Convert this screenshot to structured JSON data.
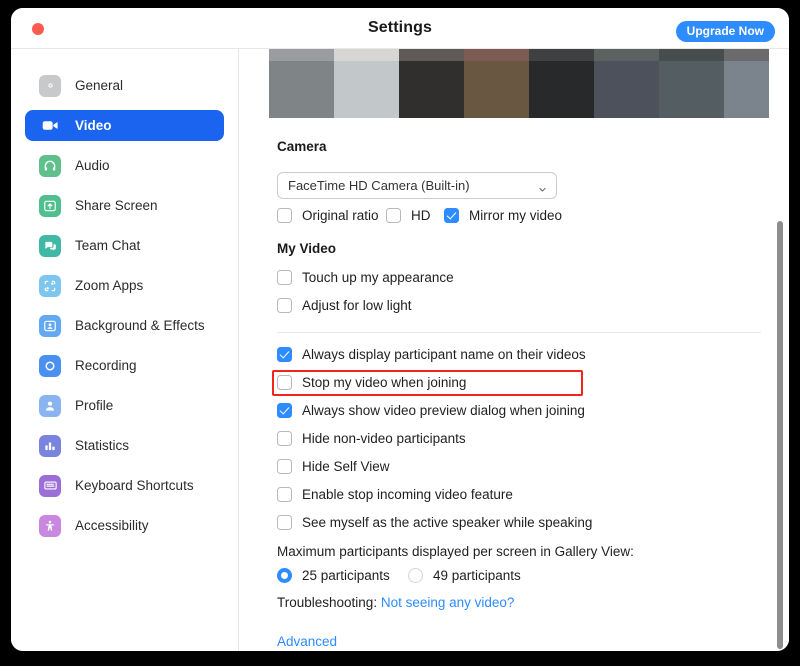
{
  "window": {
    "title": "Settings",
    "close_button": "close-window",
    "upgrade_label": "Upgrade Now",
    "accent": "#2d8cff",
    "active_nav_bg": "#1a64ef",
    "highlight_color": "#f3251a"
  },
  "sidebar": {
    "items": [
      {
        "label": "General",
        "icon": "gear-icon",
        "color": "#c8c9cb",
        "active": false
      },
      {
        "label": "Video",
        "icon": "video-camera-icon",
        "color": "#ffffff",
        "active": true
      },
      {
        "label": "Audio",
        "icon": "headphones-icon",
        "color": "#5fc08b",
        "active": false
      },
      {
        "label": "Share Screen",
        "icon": "share-screen-icon",
        "color": "#4fc08d",
        "active": false
      },
      {
        "label": "Team Chat",
        "icon": "chat-bubble-icon",
        "color": "#3fb8a5",
        "active": false
      },
      {
        "label": "Zoom Apps",
        "icon": "zoom-apps-icon",
        "color": "#7cc6f0",
        "active": false
      },
      {
        "label": "Background & Effects",
        "icon": "person-frame-icon",
        "color": "#62a8f2",
        "active": false
      },
      {
        "label": "Recording",
        "icon": "record-circle-icon",
        "color": "#4a90f0",
        "active": false
      },
      {
        "label": "Profile",
        "icon": "person-icon",
        "color": "#8ab4f0",
        "active": false
      },
      {
        "label": "Statistics",
        "icon": "bar-chart-icon",
        "color": "#7b84dd",
        "active": false
      },
      {
        "label": "Keyboard Shortcuts",
        "icon": "keyboard-icon",
        "color": "#9b6fd6",
        "active": false
      },
      {
        "label": "Accessibility",
        "icon": "accessibility-icon",
        "color": "#c888e0",
        "active": false
      }
    ]
  },
  "video_preview": {
    "name": "camera-preview-strip",
    "columns": [
      {
        "top": "#9a9c9f",
        "body": "#7f8487"
      },
      {
        "top": "#d7d6d4",
        "body": "#c2c7ca"
      },
      {
        "top": "#5f5a57",
        "body": "#302f2d"
      },
      {
        "top": "#7c5b53",
        "body": "#695741"
      },
      {
        "top": "#3f4041",
        "body": "#28292b"
      },
      {
        "top": "#5b6260",
        "body": "#4c515b"
      },
      {
        "top": "#474c4c",
        "body": "#535d62"
      },
      {
        "top": "#6b6b6b",
        "body": "#7b848c"
      }
    ]
  },
  "camera_section": {
    "title": "Camera",
    "selected_device": "FaceTime HD Camera (Built-in)",
    "options": [
      {
        "label": "Original ratio",
        "checked": false
      },
      {
        "label": "HD",
        "checked": false
      },
      {
        "label": "Mirror my video",
        "checked": true
      }
    ]
  },
  "my_video_section": {
    "title": "My Video",
    "options": [
      {
        "label": "Touch up my appearance",
        "checked": false
      },
      {
        "label": "Adjust for low light",
        "checked": false
      }
    ]
  },
  "meetings_section": {
    "options": [
      {
        "label": "Always display participant name on their videos",
        "checked": true
      },
      {
        "label": "Stop my video when joining",
        "checked": false
      },
      {
        "label": "Always show video preview dialog when joining",
        "checked": true
      },
      {
        "label": "Hide non-video participants",
        "checked": false
      },
      {
        "label": "Hide Self View",
        "checked": false
      },
      {
        "label": "Enable stop incoming video feature",
        "checked": false
      },
      {
        "label": "See myself as the active speaker while speaking",
        "checked": false
      }
    ],
    "highlighted_option_index": 1
  },
  "gallery_section": {
    "label": "Maximum participants displayed per screen in Gallery View:",
    "radios": [
      {
        "label": "25 participants",
        "checked": true
      },
      {
        "label": "49 participants",
        "checked": false
      }
    ]
  },
  "footer": {
    "troubleshooting_label": "Troubleshooting:",
    "troubleshooting_link": "Not seeing any video?",
    "advanced_link": "Advanced"
  }
}
